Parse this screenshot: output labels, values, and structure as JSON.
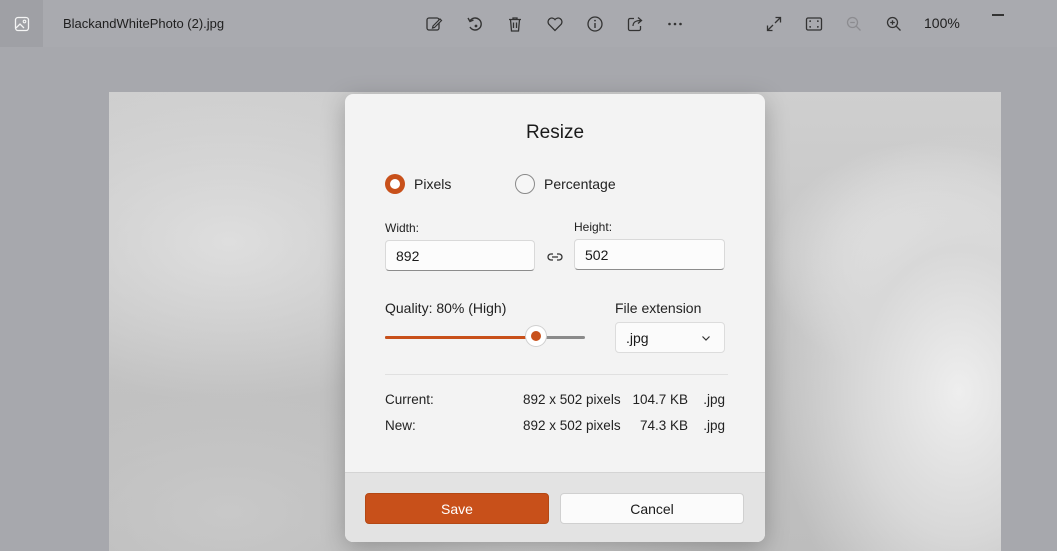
{
  "window": {
    "file_name": "BlackandWhitePhoto (2).jpg",
    "zoom": "100%"
  },
  "toolbar": {
    "icons": [
      "edit-image-icon",
      "rotate-icon",
      "delete-icon",
      "favorite-icon",
      "info-icon",
      "share-icon",
      "more-icon"
    ],
    "right_icons": [
      "expand-icon",
      "fit-to-window-icon",
      "zoom-out-icon",
      "zoom-in-icon"
    ]
  },
  "dialog": {
    "title": "Resize",
    "mode_options": {
      "pixels": "Pixels",
      "percentage": "Percentage",
      "selected": "Pixels"
    },
    "width": {
      "label": "Width:",
      "value": "892"
    },
    "height": {
      "label": "Height:",
      "value": "502"
    },
    "quality": {
      "label": "Quality: 80% (High)",
      "value": 80
    },
    "file_extension": {
      "label": "File extension",
      "value": ".jpg"
    },
    "current": {
      "label": "Current:",
      "dimensions": "892 x 502 pixels",
      "size": "104.7 KB",
      "ext": ".jpg"
    },
    "new": {
      "label": "New:",
      "dimensions": "892 x 502 pixels",
      "size": "74.3 KB",
      "ext": ".jpg"
    },
    "save_label": "Save",
    "cancel_label": "Cancel"
  },
  "colors": {
    "accent": "#c8501a",
    "dialog_bg": "#f3f3f3",
    "titlebar_bg": "#a9aaaf"
  }
}
